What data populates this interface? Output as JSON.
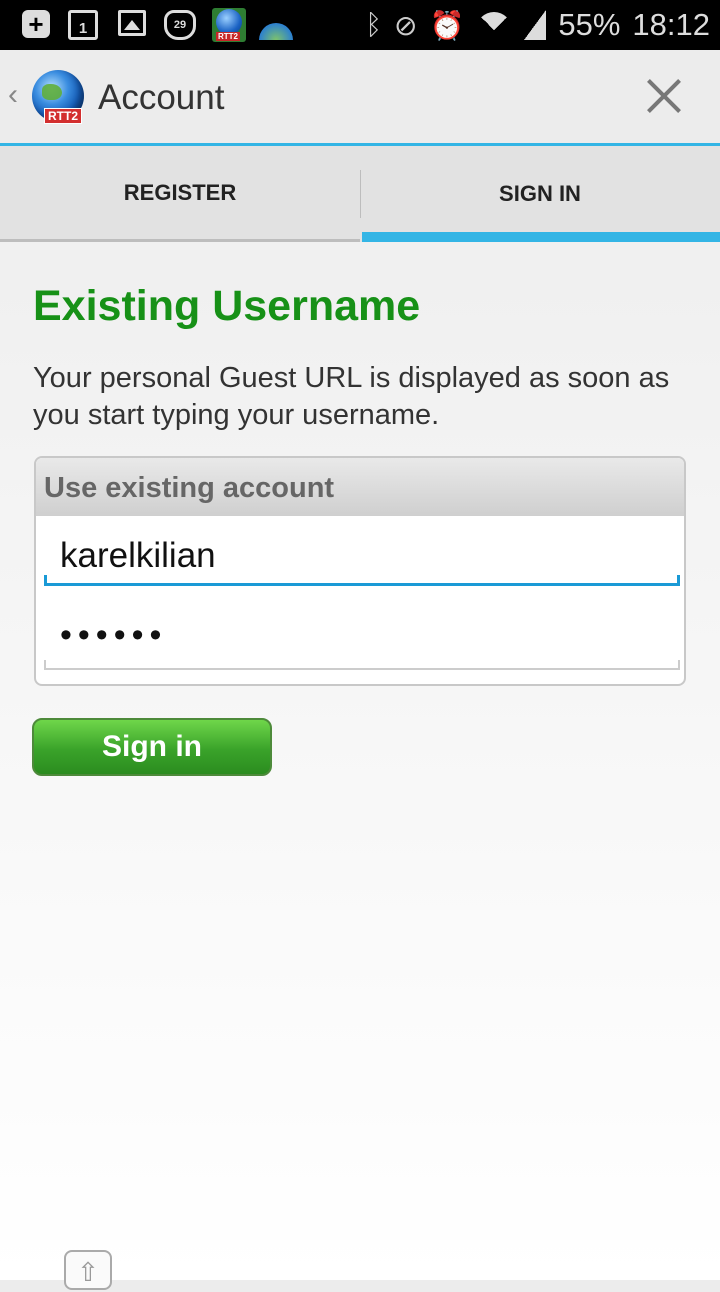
{
  "status_bar": {
    "calendar_day": "1",
    "notification_badge": "29",
    "rtt_label": "RTT2",
    "battery": "55%",
    "time": "18:12",
    "icons": [
      "add-icon",
      "calendar-icon",
      "gallery-icon",
      "cat-icon",
      "rtt2-app-icon",
      "globe-app-icon",
      "bluetooth-icon",
      "mute-icon",
      "alarm-icon",
      "wifi-icon",
      "signal-icon"
    ]
  },
  "action_bar": {
    "title": "Account",
    "logo_tag": "RTT2"
  },
  "tabs": [
    {
      "label": "REGISTER",
      "selected": false
    },
    {
      "label": "SIGN IN",
      "selected": true
    }
  ],
  "content": {
    "heading": "Existing Username",
    "description": "Your personal Guest URL is displayed as soon as you start typing your username.",
    "panel_title": "Use existing account",
    "username_value": "karelkilian",
    "password_value": "••••••",
    "signin_label": "Sign in"
  },
  "colors": {
    "accent": "#33b5e5",
    "heading_green": "#179117",
    "button_green": "#3aa32a"
  }
}
